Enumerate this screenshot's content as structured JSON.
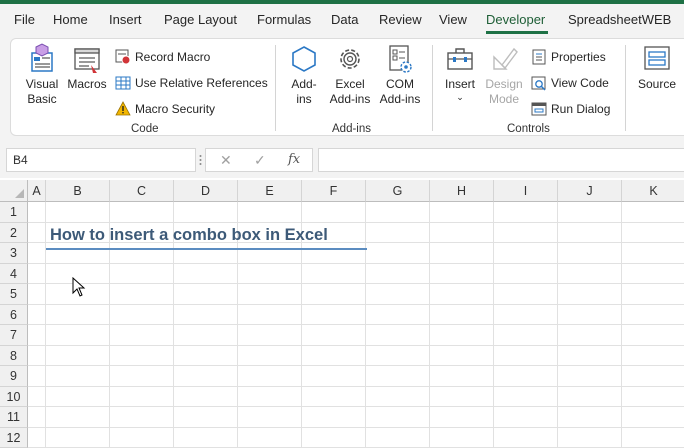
{
  "menu": {
    "items": [
      "File",
      "Home",
      "Insert",
      "Page Layout",
      "Formulas",
      "Data",
      "Review",
      "View",
      "Developer",
      "SpreadsheetWEB"
    ],
    "active": "Developer"
  },
  "ribbon": {
    "code": {
      "label": "Code",
      "visual_basic": [
        "Visual",
        "Basic"
      ],
      "macros": "Macros",
      "record_macro": "Record Macro",
      "relative_refs": "Use Relative References",
      "macro_security": "Macro Security"
    },
    "addins": {
      "label": "Add-ins",
      "addins_btn": [
        "Add-",
        "ins"
      ],
      "excel_addins": [
        "Excel",
        "Add-ins"
      ],
      "com_addins": [
        "COM",
        "Add-ins"
      ]
    },
    "controls": {
      "label": "Controls",
      "insert": "Insert",
      "design_mode": [
        "Design",
        "Mode"
      ],
      "properties": "Properties",
      "view_code": "View Code",
      "run_dialog": "Run Dialog"
    },
    "xml": {
      "source": "Source"
    }
  },
  "formula_bar": {
    "name_box": "B4",
    "formula": ""
  },
  "sheet": {
    "columns": [
      "A",
      "B",
      "C",
      "D",
      "E",
      "F",
      "G",
      "H",
      "I",
      "J",
      "K"
    ],
    "rows": [
      "1",
      "2",
      "3",
      "4",
      "5",
      "6",
      "7",
      "8",
      "9",
      "10",
      "11",
      "12"
    ],
    "title": "How to insert a combo box in Excel"
  },
  "colors": {
    "accent": "#1e7145",
    "title_text": "#3d5a78",
    "title_underline": "#5b8cc0"
  }
}
